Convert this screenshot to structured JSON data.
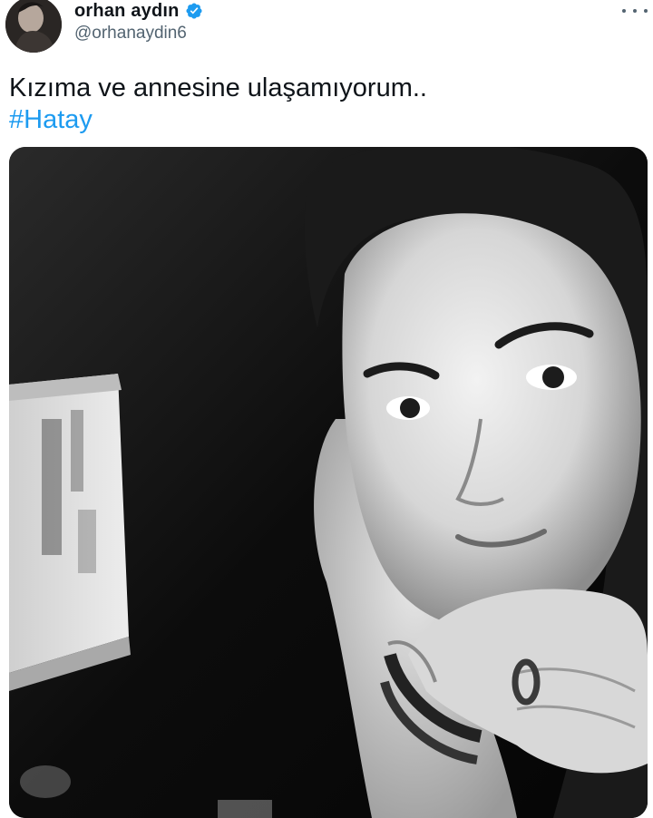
{
  "tweet": {
    "author": {
      "display_name": "orhan aydın",
      "handle": "@orhanaydin6",
      "verified": true,
      "avatar_icon": "profile-photo"
    },
    "more_icon": "ellipsis-icon",
    "text": "Kızıma ve annesine ulaşamıyorum..",
    "hashtag": "#Hatay",
    "media": {
      "kind": "black-and-white photo",
      "colors": {
        "background": "#0a0a0a"
      }
    }
  },
  "colors": {
    "hashtag": "#1d9bf0",
    "verified": "#1d9bf0",
    "secondary_text": "#536471",
    "primary_text": "#0f1419"
  }
}
